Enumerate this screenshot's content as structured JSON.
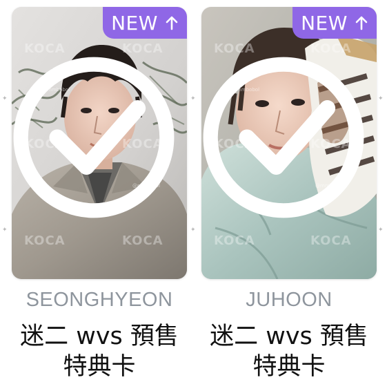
{
  "cards": [
    {
      "badge": {
        "label": "NEW",
        "icon": "arrow-up-icon"
      },
      "watermarks": [
        "KOCA",
        "KOCA",
        "KOCA",
        "KOCA",
        "KOCA",
        "KOCA"
      ],
      "credit": "@mmbobol",
      "member": "SEONGHYEON",
      "title": "迷二 wvs 預售特典卡",
      "collected_icon": "check-circle-icon"
    },
    {
      "badge": {
        "label": "NEW",
        "icon": "arrow-up-icon"
      },
      "watermarks": [
        "KOCA",
        "KOCA",
        "KOCA",
        "KOCA",
        "KOCA",
        "KOCA"
      ],
      "credit": "@mmbobol",
      "member": "JUHOON",
      "title": "迷二 wvs 預售特典卡",
      "collected_icon": "check-circle-icon"
    }
  ],
  "colors": {
    "badge": "#8f67e6",
    "member_text": "#8e959d",
    "title_text": "#111111"
  }
}
